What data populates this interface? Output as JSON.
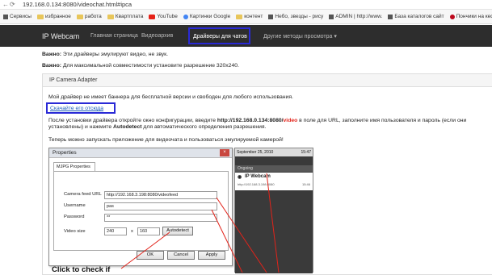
{
  "address_bar": {
    "url": "192.168.0.134:8080/videochat.html#ipca"
  },
  "bookmarks": [
    {
      "label": "Сервисы",
      "icon": "apps-icon"
    },
    {
      "label": "избранное",
      "icon": "folder-icon"
    },
    {
      "label": "работа",
      "icon": "folder-icon"
    },
    {
      "label": "Квартплата",
      "icon": "folder-icon"
    },
    {
      "label": "YouTube",
      "icon": "youtube-icon"
    },
    {
      "label": "Картинки Google",
      "icon": "google-icon"
    },
    {
      "label": "контент",
      "icon": "folder-icon"
    },
    {
      "label": "Небо, звезды - рису",
      "icon": "page-icon"
    },
    {
      "label": "ADMIN | http://www.",
      "icon": "page-icon"
    },
    {
      "label": "База каталогов сайт",
      "icon": "page-icon"
    },
    {
      "label": "Пончики на кефир",
      "icon": "pinterest-icon"
    }
  ],
  "nav": {
    "brand": "IP Webcam",
    "items": [
      "Главная страница",
      "Видеоархив",
      "Драйверы для чатов",
      "Другие методы просмотра"
    ],
    "caret": "▾"
  },
  "notes": {
    "n1_b": "Важно:",
    "n1": " Эти драйверы эмулируют видео, не звук.",
    "n2_b": "Важно:",
    "n2": " Для максимальной совместимости установите разрешение 320x240."
  },
  "panel": {
    "title": "IP Camera Adapter",
    "p1": "Мой драйвер не имеет баннера для бесплатной версии и свободен для любого использования.",
    "download": "Скачайте его отсюда",
    "p2a": "После установки драйвера откройте окно конфигурации, введите ",
    "p2url": "http://192.168.0.134:8080/",
    "p2vid": "video",
    "p2b": " в поле для URL, заполните имя пользователя и пароль (если они",
    "p2c": "установлены) и нажмите ",
    "p2auto": "Autodetect",
    "p2d": " для автоматического определения разрешения.",
    "p3": "Теперь можно запускать приложение для видеочата и пользоваться эмулируемой камерой!"
  },
  "dialog": {
    "title": "Properties",
    "close": "×",
    "tab": "MJPG Properties",
    "feed_label": "Camera feed URL",
    "feed_value": "http://192.168.3.198:8080/videofeed",
    "user_label": "Username",
    "user_value": "pas",
    "pass_label": "Password",
    "pass_value": "**",
    "size_label": "Video size",
    "width": "240",
    "x": "x",
    "height": "160",
    "autodetect": "Autodetect",
    "ok": "OK",
    "cancel": "Cancel",
    "apply": "Apply"
  },
  "phone": {
    "date": "September 25, 2010",
    "time": "15:47",
    "ongoing": "Ongoing",
    "app": "IP Webcam",
    "app_url": "http://192.168.3.198:8080",
    "app_time": "15:46"
  },
  "annotation": "Click to check if"
}
